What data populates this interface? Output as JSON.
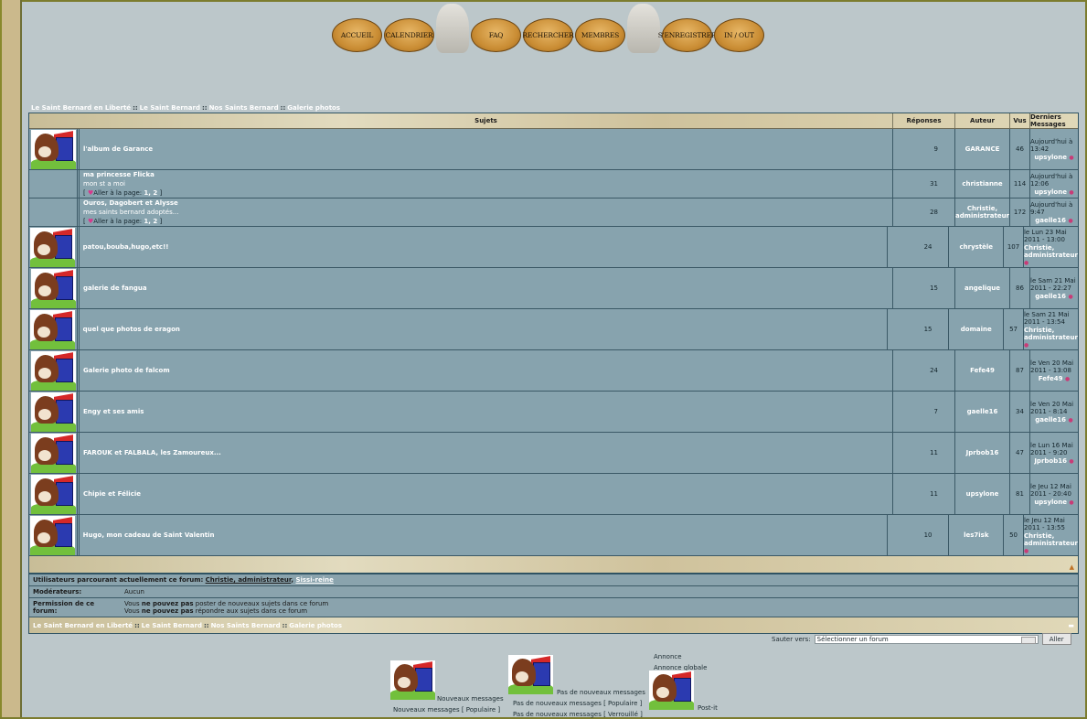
{
  "nav": {
    "buttons": [
      "ACCUEIL",
      "CALENDRIER",
      "FAQ",
      "RECHERCHER",
      "MEMBRES",
      "S'ENREGISTRER",
      "IN / OUT"
    ]
  },
  "breadcrumb": [
    "Le Saint Bernard en Liberté",
    "Le Saint Bernard",
    "Nos Saints Bernard",
    "Galerie photos"
  ],
  "table": {
    "headers": {
      "topics": "Sujets",
      "replies": "Réponses",
      "author": "Auteur",
      "views": "Vus",
      "last": "Derniers Messages"
    },
    "rows": [
      {
        "title": "l'album de Garance",
        "desc": "",
        "pages": "",
        "replies": "9",
        "author": "GARANCE",
        "views": "46",
        "last_date": "Aujourd'hui à 13:42",
        "last_user": "upsylone",
        "icon": true
      },
      {
        "title": "ma princesse Flicka",
        "desc": "mon st a moi",
        "pages": "1, 2",
        "replies": "31",
        "author": "christianne",
        "views": "114",
        "last_date": "Aujourd'hui à 12:06",
        "last_user": "upsylone",
        "icon": false
      },
      {
        "title": "Ouros, Dagobert et Alysse",
        "desc": "mes saints bernard adoptés...",
        "pages": "1, 2",
        "replies": "28",
        "author": "Christie, administrateur",
        "views": "172",
        "last_date": "Aujourd'hui à 9:47",
        "last_user": "gaelle16",
        "icon": false
      },
      {
        "title": "patou,bouba,hugo,etc!!",
        "desc": "",
        "pages": "",
        "replies": "24",
        "author": "chrystèle",
        "views": "107",
        "last_date": "le Lun 23 Mai 2011 - 13:00",
        "last_user": "Christie, administrateur",
        "icon": true
      },
      {
        "title": "galerie de fangua",
        "desc": "",
        "pages": "",
        "replies": "15",
        "author": "angelique",
        "views": "86",
        "last_date": "le Sam 21 Mai 2011 - 22:27",
        "last_user": "gaelle16",
        "icon": true
      },
      {
        "title": "quel que photos de eragon",
        "desc": "",
        "pages": "",
        "replies": "15",
        "author": "domaine",
        "views": "57",
        "last_date": "le Sam 21 Mai 2011 - 13:54",
        "last_user": "Christie, administrateur",
        "icon": true
      },
      {
        "title": "Galerie photo de falcom",
        "desc": "",
        "pages": "",
        "replies": "24",
        "author": "Fefe49",
        "views": "87",
        "last_date": "le Ven 20 Mai 2011 - 13:08",
        "last_user": "Fefe49",
        "icon": true
      },
      {
        "title": "Engy et ses amis",
        "desc": "",
        "pages": "",
        "replies": "7",
        "author": "gaelle16",
        "views": "34",
        "last_date": "le Ven 20 Mai 2011 - 8:14",
        "last_user": "gaelle16",
        "icon": true
      },
      {
        "title": "FAROUK et FALBALA, les Zamoureux...",
        "desc": "",
        "pages": "",
        "replies": "11",
        "author": "Jprbob16",
        "views": "47",
        "last_date": "le Lun 16 Mai 2011 - 9:20",
        "last_user": "Jprbob16",
        "icon": true
      },
      {
        "title": "Chipie et Félicie",
        "desc": "",
        "pages": "",
        "replies": "11",
        "author": "upsylone",
        "views": "81",
        "last_date": "le Jeu 12 Mai 2011 - 20:40",
        "last_user": "upsylone",
        "icon": true
      },
      {
        "title": "Hugo, mon cadeau de Saint Valentin",
        "desc": "",
        "pages": "",
        "replies": "10",
        "author": "les7isk",
        "views": "50",
        "last_date": "le Jeu 12 Mai 2011 - 13:55",
        "last_user": "Christie, administrateur",
        "icon": true
      }
    ],
    "go_to_page": "Aller à la page:"
  },
  "info": {
    "browsing_label": "Utilisateurs parcourant actuellement ce forum:",
    "browsing_user": "Christie, administrateur",
    "browsing_user2": "Sissi-reine",
    "moderators_label": "Modérateurs:",
    "moderators_value": "Aucun",
    "permission_label": "Permission de ce forum:",
    "perm1_a": "Vous ",
    "perm1_b": "ne pouvez pas",
    "perm1_c": " poster de nouveaux sujets dans ce forum",
    "perm2_a": "Vous ",
    "perm2_b": "ne pouvez pas",
    "perm2_c": " répondre aux sujets dans ce forum"
  },
  "jump": {
    "label": "Sauter vers:",
    "select": "Sélectionner un forum",
    "button": "Aller"
  },
  "legend": {
    "new": "Nouveaux messages",
    "new_popular": "Nouveaux messages [ Populaire ]",
    "no_new": "Pas de nouveaux messages",
    "no_new_popular": "Pas de nouveaux messages [ Populaire ]",
    "no_new_locked": "Pas de nouveaux messages [ Verrouillé ]",
    "announce": "Annonce",
    "global_announce": "Annonce globale",
    "postit": "Post-it"
  }
}
